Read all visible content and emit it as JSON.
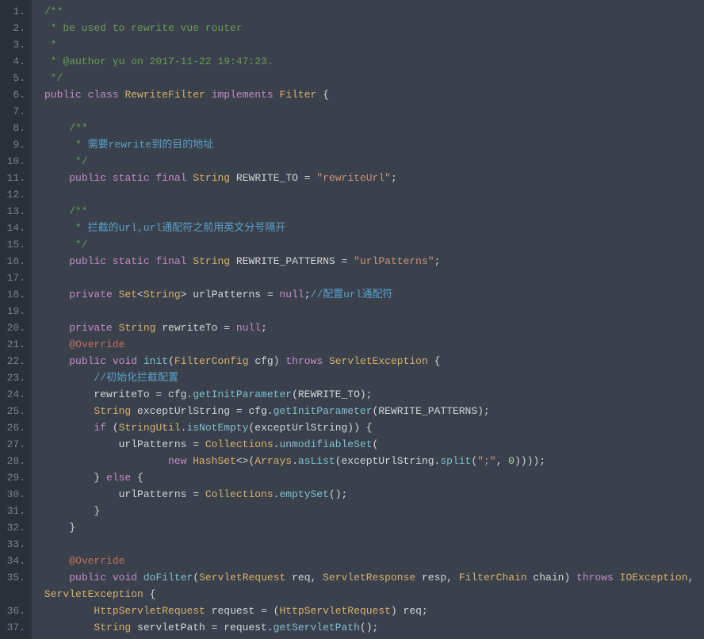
{
  "lineNumbers": [
    "1.",
    "2.",
    "3.",
    "4.",
    "5.",
    "6.",
    "7.",
    "8.",
    "9.",
    "10.",
    "11.",
    "12.",
    "13.",
    "14.",
    "15.",
    "16.",
    "17.",
    "18.",
    "19.",
    "20.",
    "21.",
    "22.",
    "23.",
    "24.",
    "25.",
    "26.",
    "27.",
    "28.",
    "29.",
    "30.",
    "31.",
    "32.",
    "33.",
    "34.",
    "35.",
    "36.",
    "37."
  ],
  "code": {
    "lines": [
      [
        {
          "c": "c-comment",
          "t": "/**"
        }
      ],
      [
        {
          "c": "c-comment",
          "t": " * be used to rewrite vue router"
        }
      ],
      [
        {
          "c": "c-comment",
          "t": " *"
        }
      ],
      [
        {
          "c": "c-comment",
          "t": " * @author yu on 2017-11-22 19:47:23."
        }
      ],
      [
        {
          "c": "c-comment",
          "t": " */"
        }
      ],
      [
        {
          "c": "c-keyword",
          "t": "public"
        },
        {
          "c": "c-punct",
          "t": " "
        },
        {
          "c": "c-keyword",
          "t": "class"
        },
        {
          "c": "c-punct",
          "t": " "
        },
        {
          "c": "c-class",
          "t": "RewriteFilter"
        },
        {
          "c": "c-punct",
          "t": " "
        },
        {
          "c": "c-keyword",
          "t": "implements"
        },
        {
          "c": "c-punct",
          "t": " "
        },
        {
          "c": "c-type",
          "t": "Filter"
        },
        {
          "c": "c-punct",
          "t": " {"
        }
      ],
      [],
      [
        {
          "c": "c-punct",
          "t": "    "
        },
        {
          "c": "c-comment",
          "t": "/**"
        }
      ],
      [
        {
          "c": "c-punct",
          "t": "    "
        },
        {
          "c": "c-comment",
          "t": " * "
        },
        {
          "c": "c-comment-cn",
          "t": "需要rewrite到的目的地址"
        }
      ],
      [
        {
          "c": "c-punct",
          "t": "    "
        },
        {
          "c": "c-comment",
          "t": " */"
        }
      ],
      [
        {
          "c": "c-punct",
          "t": "    "
        },
        {
          "c": "c-keyword",
          "t": "public"
        },
        {
          "c": "c-punct",
          "t": " "
        },
        {
          "c": "c-keyword",
          "t": "static"
        },
        {
          "c": "c-punct",
          "t": " "
        },
        {
          "c": "c-keyword",
          "t": "final"
        },
        {
          "c": "c-punct",
          "t": " "
        },
        {
          "c": "c-type",
          "t": "String"
        },
        {
          "c": "c-punct",
          "t": " REWRITE_TO = "
        },
        {
          "c": "c-string",
          "t": "\"rewriteUrl\""
        },
        {
          "c": "c-punct",
          "t": ";"
        }
      ],
      [],
      [
        {
          "c": "c-punct",
          "t": "    "
        },
        {
          "c": "c-comment",
          "t": "/**"
        }
      ],
      [
        {
          "c": "c-punct",
          "t": "    "
        },
        {
          "c": "c-comment",
          "t": " * "
        },
        {
          "c": "c-comment-cn",
          "t": "拦截的url,url通配符之前用英文分号隔开"
        }
      ],
      [
        {
          "c": "c-punct",
          "t": "    "
        },
        {
          "c": "c-comment",
          "t": " */"
        }
      ],
      [
        {
          "c": "c-punct",
          "t": "    "
        },
        {
          "c": "c-keyword",
          "t": "public"
        },
        {
          "c": "c-punct",
          "t": " "
        },
        {
          "c": "c-keyword",
          "t": "static"
        },
        {
          "c": "c-punct",
          "t": " "
        },
        {
          "c": "c-keyword",
          "t": "final"
        },
        {
          "c": "c-punct",
          "t": " "
        },
        {
          "c": "c-type",
          "t": "String"
        },
        {
          "c": "c-punct",
          "t": " REWRITE_PATTERNS = "
        },
        {
          "c": "c-string",
          "t": "\"urlPatterns\""
        },
        {
          "c": "c-punct",
          "t": ";"
        }
      ],
      [],
      [
        {
          "c": "c-punct",
          "t": "    "
        },
        {
          "c": "c-keyword",
          "t": "private"
        },
        {
          "c": "c-punct",
          "t": " "
        },
        {
          "c": "c-type",
          "t": "Set"
        },
        {
          "c": "c-punct",
          "t": "<"
        },
        {
          "c": "c-type",
          "t": "String"
        },
        {
          "c": "c-punct",
          "t": "> urlPatterns = "
        },
        {
          "c": "c-keyword",
          "t": "null"
        },
        {
          "c": "c-punct",
          "t": ";"
        },
        {
          "c": "c-comment-cn",
          "t": "//配置url通配符"
        }
      ],
      [],
      [
        {
          "c": "c-punct",
          "t": "    "
        },
        {
          "c": "c-keyword",
          "t": "private"
        },
        {
          "c": "c-punct",
          "t": " "
        },
        {
          "c": "c-type",
          "t": "String"
        },
        {
          "c": "c-punct",
          "t": " rewriteTo = "
        },
        {
          "c": "c-keyword",
          "t": "null"
        },
        {
          "c": "c-punct",
          "t": ";"
        }
      ],
      [
        {
          "c": "c-punct",
          "t": "    "
        },
        {
          "c": "c-annotation",
          "t": "@Override"
        }
      ],
      [
        {
          "c": "c-punct",
          "t": "    "
        },
        {
          "c": "c-keyword",
          "t": "public"
        },
        {
          "c": "c-punct",
          "t": " "
        },
        {
          "c": "c-keyword",
          "t": "void"
        },
        {
          "c": "c-punct",
          "t": " "
        },
        {
          "c": "c-method",
          "t": "init"
        },
        {
          "c": "c-punct",
          "t": "("
        },
        {
          "c": "c-type",
          "t": "FilterConfig"
        },
        {
          "c": "c-punct",
          "t": " cfg) "
        },
        {
          "c": "c-keyword",
          "t": "throws"
        },
        {
          "c": "c-punct",
          "t": " "
        },
        {
          "c": "c-type",
          "t": "ServletException"
        },
        {
          "c": "c-punct",
          "t": " {"
        }
      ],
      [
        {
          "c": "c-punct",
          "t": "        "
        },
        {
          "c": "c-comment-cn",
          "t": "//初始化拦截配置"
        }
      ],
      [
        {
          "c": "c-punct",
          "t": "        rewriteTo = cfg."
        },
        {
          "c": "c-method",
          "t": "getInitParameter"
        },
        {
          "c": "c-punct",
          "t": "(REWRITE_TO);"
        }
      ],
      [
        {
          "c": "c-punct",
          "t": "        "
        },
        {
          "c": "c-type",
          "t": "String"
        },
        {
          "c": "c-punct",
          "t": " exceptUrlString = cfg."
        },
        {
          "c": "c-method",
          "t": "getInitParameter"
        },
        {
          "c": "c-punct",
          "t": "(REWRITE_PATTERNS);"
        }
      ],
      [
        {
          "c": "c-punct",
          "t": "        "
        },
        {
          "c": "c-keyword",
          "t": "if"
        },
        {
          "c": "c-punct",
          "t": " ("
        },
        {
          "c": "c-type",
          "t": "StringUtil"
        },
        {
          "c": "c-punct",
          "t": "."
        },
        {
          "c": "c-method",
          "t": "isNotEmpty"
        },
        {
          "c": "c-punct",
          "t": "(exceptUrlString)) {"
        }
      ],
      [
        {
          "c": "c-punct",
          "t": "            urlPatterns = "
        },
        {
          "c": "c-type",
          "t": "Collections"
        },
        {
          "c": "c-punct",
          "t": "."
        },
        {
          "c": "c-method",
          "t": "unmodifiableSet"
        },
        {
          "c": "c-punct",
          "t": "("
        }
      ],
      [
        {
          "c": "c-punct",
          "t": "                    "
        },
        {
          "c": "c-keyword",
          "t": "new"
        },
        {
          "c": "c-punct",
          "t": " "
        },
        {
          "c": "c-type",
          "t": "HashSet"
        },
        {
          "c": "c-punct",
          "t": "<>("
        },
        {
          "c": "c-type",
          "t": "Arrays"
        },
        {
          "c": "c-punct",
          "t": "."
        },
        {
          "c": "c-method",
          "t": "asList"
        },
        {
          "c": "c-punct",
          "t": "(exceptUrlString."
        },
        {
          "c": "c-method",
          "t": "split"
        },
        {
          "c": "c-punct",
          "t": "("
        },
        {
          "c": "c-string",
          "t": "\";\""
        },
        {
          "c": "c-punct",
          "t": ", "
        },
        {
          "c": "c-number",
          "t": "0"
        },
        {
          "c": "c-punct",
          "t": "))));"
        }
      ],
      [
        {
          "c": "c-punct",
          "t": "        } "
        },
        {
          "c": "c-keyword",
          "t": "else"
        },
        {
          "c": "c-punct",
          "t": " {"
        }
      ],
      [
        {
          "c": "c-punct",
          "t": "            urlPatterns = "
        },
        {
          "c": "c-type",
          "t": "Collections"
        },
        {
          "c": "c-punct",
          "t": "."
        },
        {
          "c": "c-method",
          "t": "emptySet"
        },
        {
          "c": "c-punct",
          "t": "();"
        }
      ],
      [
        {
          "c": "c-punct",
          "t": "        }"
        }
      ],
      [
        {
          "c": "c-punct",
          "t": "    }"
        }
      ],
      [],
      [
        {
          "c": "c-punct",
          "t": "    "
        },
        {
          "c": "c-annotation",
          "t": "@Override"
        }
      ],
      [
        {
          "c": "c-punct",
          "t": "    "
        },
        {
          "c": "c-keyword",
          "t": "public"
        },
        {
          "c": "c-punct",
          "t": " "
        },
        {
          "c": "c-keyword",
          "t": "void"
        },
        {
          "c": "c-punct",
          "t": " "
        },
        {
          "c": "c-method",
          "t": "doFilter"
        },
        {
          "c": "c-punct",
          "t": "("
        },
        {
          "c": "c-type",
          "t": "ServletRequest"
        },
        {
          "c": "c-punct",
          "t": " req, "
        },
        {
          "c": "c-type",
          "t": "ServletResponse"
        },
        {
          "c": "c-punct",
          "t": " resp, "
        },
        {
          "c": "c-type",
          "t": "FilterChain"
        },
        {
          "c": "c-punct",
          "t": " chain) "
        },
        {
          "c": "c-keyword",
          "t": "throws"
        },
        {
          "c": "c-punct",
          "t": " "
        },
        {
          "c": "c-type",
          "t": "IOException"
        },
        {
          "c": "c-punct",
          "t": ", "
        },
        {
          "c": "c-type",
          "t": "ServletException"
        },
        {
          "c": "c-punct",
          "t": " {"
        }
      ],
      [
        {
          "c": "c-punct",
          "t": "        "
        },
        {
          "c": "c-type",
          "t": "HttpServletRequest"
        },
        {
          "c": "c-punct",
          "t": " request = ("
        },
        {
          "c": "c-type",
          "t": "HttpServletRequest"
        },
        {
          "c": "c-punct",
          "t": ") req;"
        }
      ],
      [
        {
          "c": "c-punct",
          "t": "        "
        },
        {
          "c": "c-type",
          "t": "String"
        },
        {
          "c": "c-punct",
          "t": " servletPath = request."
        },
        {
          "c": "c-method",
          "t": "getServletPath"
        },
        {
          "c": "c-punct",
          "t": "();"
        }
      ]
    ]
  }
}
